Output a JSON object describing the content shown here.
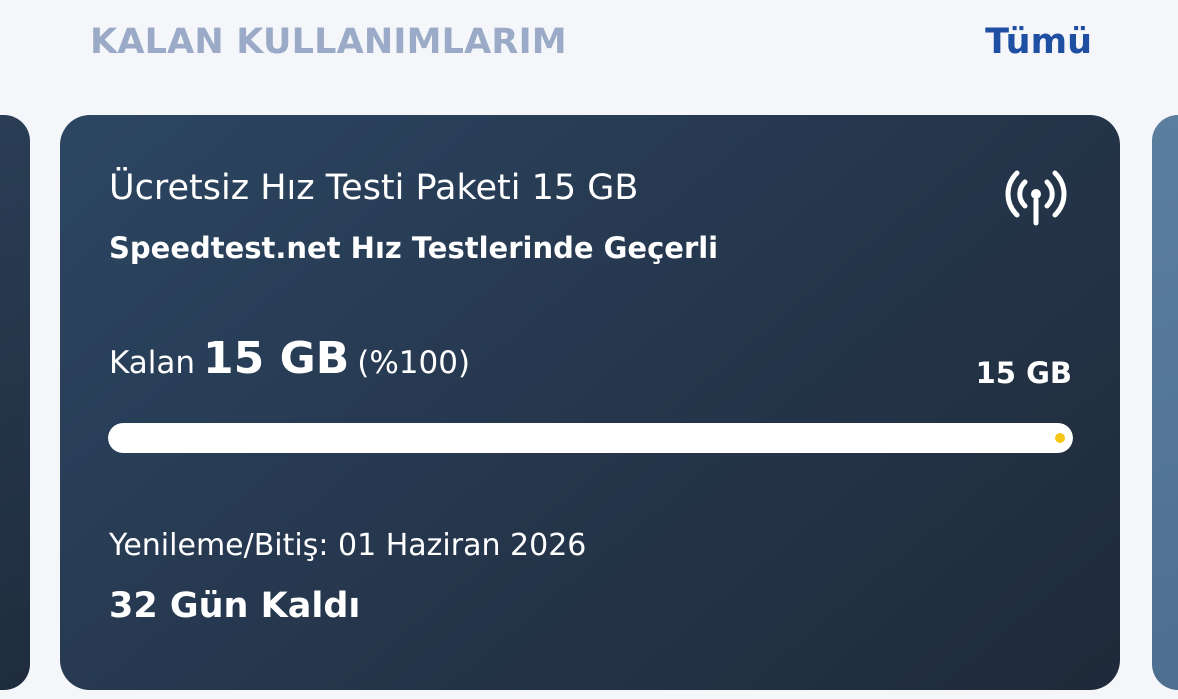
{
  "header": {
    "title": "KALAN KULLANIMLARIM",
    "see_all_label": "Tümü"
  },
  "card": {
    "package_name": "Ücretsiz Hız Testi Paketi 15 GB",
    "description": "Speedtest.net Hız Testlerinde Geçerli",
    "icon": "signal-antenna-icon",
    "remaining_label": "Kalan",
    "remaining_value": "15 GB",
    "remaining_percent": "(%100)",
    "total_value": "15 GB",
    "progress_fraction": 1.0,
    "renewal_text": "Yenileme/Bitiş: 01 Haziran 2026",
    "days_left_text": "32 Gün Kaldı"
  },
  "colors": {
    "background": "#f4f6f9",
    "section_title": "#9aaac7",
    "link": "#1f4fa3",
    "card_from": "#2c4662",
    "card_to": "#1f2a39",
    "progress_fill": "#ffffff",
    "progress_dot": "#f5c518",
    "next_card": "#5b7f9f"
  }
}
